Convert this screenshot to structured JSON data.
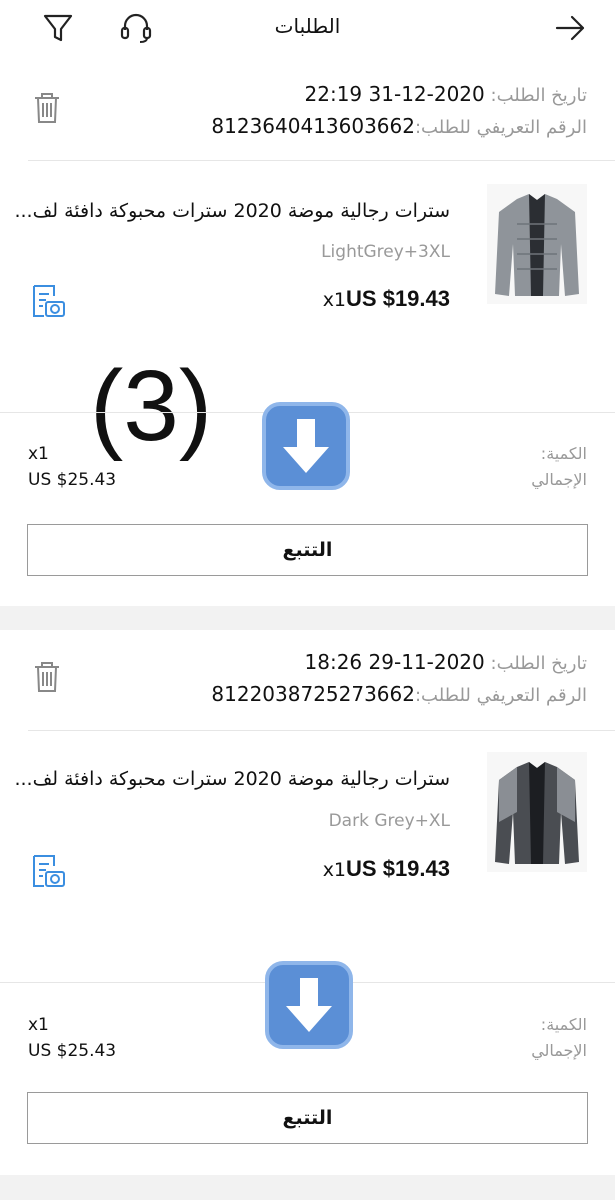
{
  "header": {
    "title": "الطلبات",
    "back_icon": "arrow-right-icon",
    "filter_icon": "filter-icon",
    "support_icon": "headset-icon"
  },
  "annotation": {
    "number": "(3)"
  },
  "orders": [
    {
      "date_label": "تاريخ الطلب:",
      "date_value": "2020-12-31 22:19",
      "id_label": "الرقم التعريفي للطلب:",
      "id_value": "8123640413603662",
      "product_title": "سترات رجالية موضة 2020 سترات محبوكة دافئة لف...",
      "variant": "LightGrey+3XL",
      "unit_qty": "x1",
      "price": "US $19.43",
      "qty_label": "الكمية:",
      "qty_value": "x1",
      "total_label": "الإجمالي",
      "total_value": "US $25.43",
      "track_label": "التتبع"
    },
    {
      "date_label": "تاريخ الطلب:",
      "date_value": "2020-11-29 18:26",
      "id_label": "الرقم التعريفي للطلب:",
      "id_value": "8122038725273662",
      "product_title": "سترات رجالية موضة 2020 سترات محبوكة دافئة لف...",
      "variant": "Dark Grey+XL",
      "unit_qty": "x1",
      "price": "US $19.43",
      "qty_label": "الكمية:",
      "qty_value": "x1",
      "total_label": "الإجمالي",
      "total_value": "US $25.43",
      "track_label": "التتبع"
    }
  ],
  "colors": {
    "accent_blue": "#3b8ee0",
    "label_grey": "#999999",
    "emoji_blue": "#5b8fd6"
  }
}
